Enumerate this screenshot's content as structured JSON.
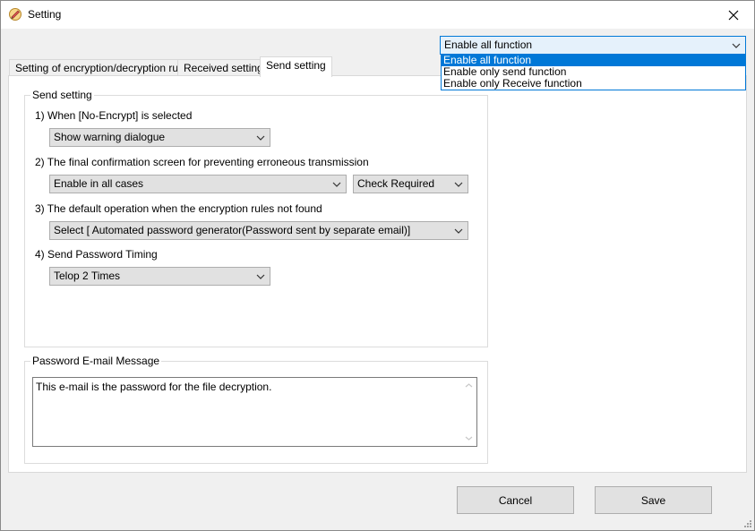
{
  "window": {
    "title": "Setting"
  },
  "mode": {
    "selected": "Enable all function",
    "options": [
      "Enable all function",
      "Enable only send function",
      "Enable only Receive function"
    ]
  },
  "tabs": [
    {
      "label": "Setting of encryption/decryption rules",
      "active": false
    },
    {
      "label": "Received setting",
      "active": false
    },
    {
      "label": "Send setting",
      "active": true
    }
  ],
  "send_setting": {
    "legend": "Send setting",
    "q1": {
      "label": "1) When [No-Encrypt] is selected",
      "value": "Show warning dialogue"
    },
    "q2": {
      "label": "2) The final confirmation screen for preventing erroneous transmission",
      "value": "Enable in all cases",
      "value2": "Check Required"
    },
    "q3": {
      "label": "3) The default operation when the encryption rules not found",
      "value": "Select [ Automated password generator(Password sent by separate email)]"
    },
    "q4": {
      "label": "4) Send Password Timing",
      "value": "Telop 2 Times"
    }
  },
  "password_message": {
    "legend": "Password E-mail Message",
    "text": "This e-mail is the password for the file decryption."
  },
  "buttons": {
    "cancel": "Cancel",
    "save": "Save"
  },
  "colors": {
    "accent": "#0078d7",
    "window_bg": "#f0f0f0",
    "panel_bg": "#ffffff"
  }
}
